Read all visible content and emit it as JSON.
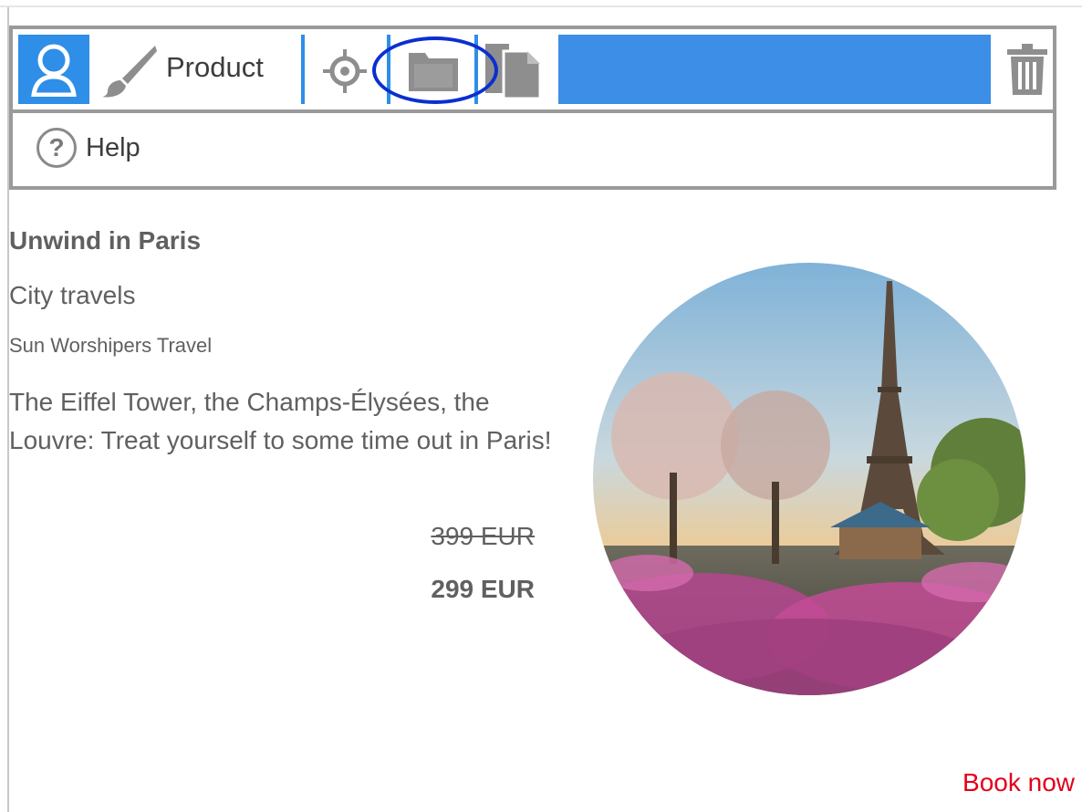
{
  "toolbar": {
    "user_icon": "user-icon",
    "brush_icon": "paintbrush-icon",
    "product_label": "Product",
    "crosshair_icon": "crosshair-icon",
    "folder_icon": "folder-icon",
    "documents_icon": "documents-icon",
    "trash_icon": "trash-icon",
    "help_icon": "question-circle-icon",
    "help_label": "Help",
    "accent_color": "#2e8ee8",
    "highlight_color": "#0a2fd0"
  },
  "offer": {
    "title": "Unwind in Paris",
    "category": "City travels",
    "provider": "Sun Worshipers Travel",
    "description": "The Eiffel Tower, the Champs-Élysées, the Louvre: Treat yourself to some time out in Paris!",
    "old_price": "399 EUR",
    "new_price": "299 EUR",
    "image": "eiffel-tower-photo",
    "cta_label": "Book now",
    "cta_color": "#e3001b"
  }
}
